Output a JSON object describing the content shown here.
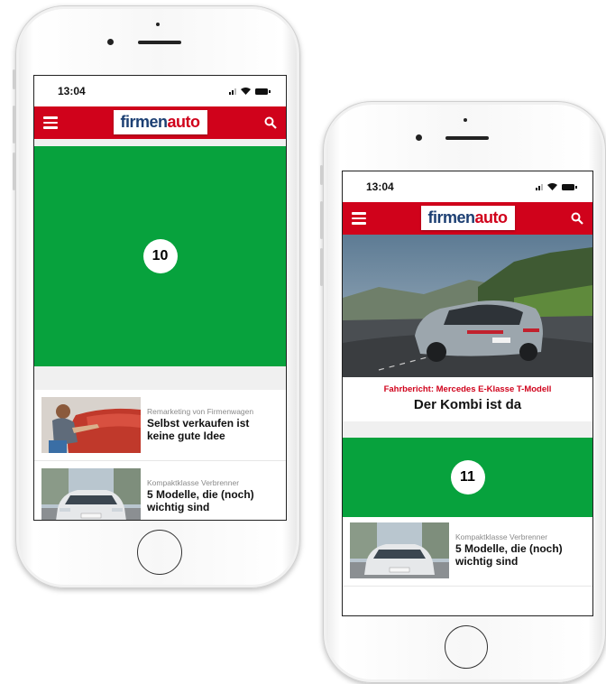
{
  "phones": [
    {
      "status_time": "13:04",
      "logo": {
        "part1": "firmen",
        "part2": "auto"
      },
      "ad_number": "10",
      "articles": [
        {
          "kicker": "Remarketing von Firmenwagen",
          "headline": "Selbst verkaufen ist keine gute Idee"
        },
        {
          "kicker": "Kompaktklasse Verbrenner",
          "headline": "5 Modelle, die (noch) wichtig sind"
        }
      ]
    },
    {
      "status_time": "13:04",
      "logo": {
        "part1": "firmen",
        "part2": "auto"
      },
      "hero": {
        "kicker": "Fahrbericht: Mercedes E-Klasse T-Modell",
        "title": "Der Kombi ist da"
      },
      "ad_number": "11",
      "articles": [
        {
          "kicker": "Kompaktklasse Verbrenner",
          "headline": "5 Modelle, die (noch) wichtig sind"
        }
      ]
    }
  ],
  "colors": {
    "brand_red": "#d0021b",
    "ad_green": "#07a23d",
    "logo_blue": "#1c3f73"
  },
  "icons": [
    "hamburger-menu-icon",
    "search-icon",
    "signal-icon",
    "wifi-icon",
    "battery-icon"
  ]
}
